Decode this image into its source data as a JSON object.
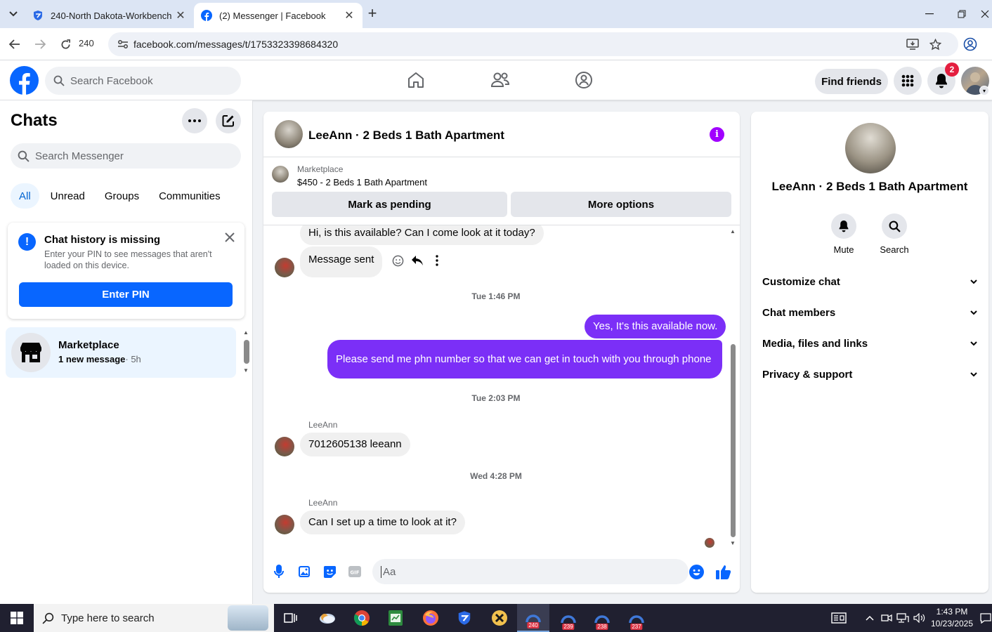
{
  "browser": {
    "tabs": [
      {
        "title": "240-North Dakota-Workbench",
        "active": false
      },
      {
        "title": "(2) Messenger | Facebook",
        "active": true
      }
    ],
    "profile_count": "240",
    "url": "facebook.com/messages/t/1753323398684320"
  },
  "header": {
    "search_placeholder": "Search Facebook",
    "find_friends": "Find friends",
    "notification_count": "2"
  },
  "sidebar": {
    "title": "Chats",
    "search_placeholder": "Search Messenger",
    "filters": [
      "All",
      "Unread",
      "Groups",
      "Communities"
    ],
    "history_card": {
      "title": "Chat history is missing",
      "body": "Enter your PIN to see messages that aren't loaded on this device.",
      "button": "Enter PIN"
    },
    "chats": [
      {
        "name": "Marketplace",
        "preview": "1 new message",
        "time": "· 5h"
      }
    ]
  },
  "conversation": {
    "title": "LeeAnn · 2 Beds 1 Bath Apartment",
    "marketplace": {
      "label": "Marketplace",
      "item": "$450 - 2 Beds 1 Bath Apartment",
      "mark_pending": "Mark as pending",
      "more_options": "More options"
    },
    "messages": {
      "m1": "Hi, is this available? Can I come look at it today?",
      "m2": "Message sent",
      "ts1": "Tue 1:46 PM",
      "m3": "Yes, It's this available now.",
      "m4": "Please send me  phn  number so that we can get in touch with you through phone",
      "ts2": "Tue 2:03 PM",
      "sender1": "LeeAnn",
      "m5": "7012605138 leeann",
      "ts3": "Wed 4:28 PM",
      "sender2": "LeeAnn",
      "m6": "Can I set up a time to look at it?"
    },
    "composer_placeholder": "Aa"
  },
  "right_panel": {
    "name": "LeeAnn · 2 Beds 1 Bath Apartment",
    "mute": "Mute",
    "search": "Search",
    "sections": [
      "Customize chat",
      "Chat members",
      "Media, files and links",
      "Privacy & support"
    ]
  },
  "taskbar": {
    "search_placeholder": "Type here to search",
    "apps": [
      "240",
      "239",
      "238",
      "237"
    ],
    "time": "1:43 PM",
    "date": "10/23/2025"
  },
  "colors": {
    "brand": "#0866ff",
    "outgoing_bubble": "#7b2ff7",
    "info_icon": "#a100ff",
    "badge": "#e41e3f"
  }
}
